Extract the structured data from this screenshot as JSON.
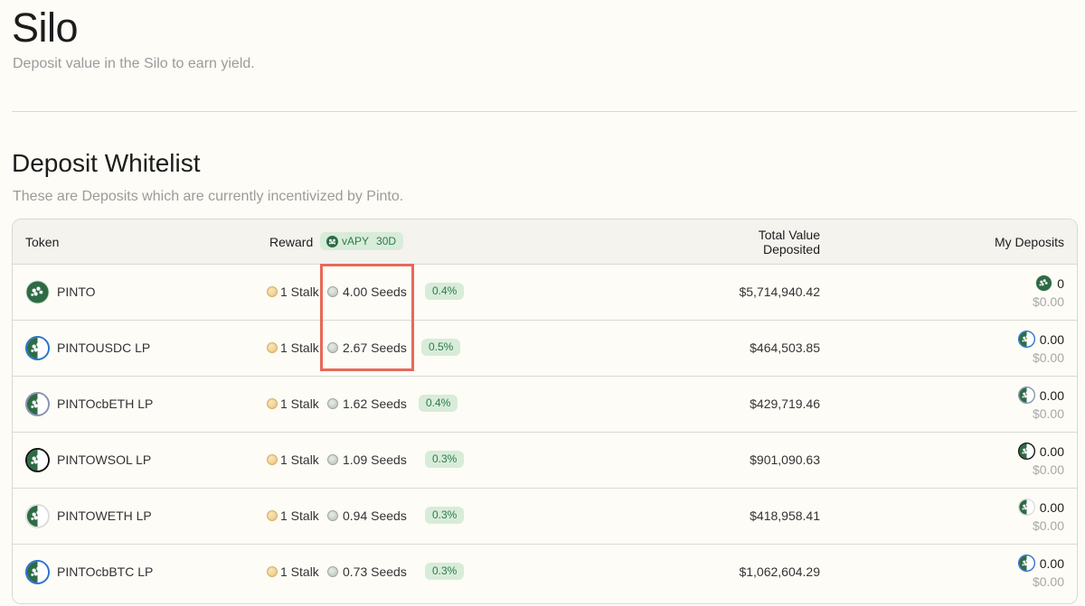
{
  "page": {
    "title": "Silo",
    "subtitle": "Deposit value in the Silo to earn yield."
  },
  "section": {
    "title": "Deposit Whitelist",
    "subtitle": "These are Deposits which are currently incentivized by Pinto."
  },
  "table": {
    "headers": {
      "token": "Token",
      "reward": "Reward",
      "vapy_label": "vAPY",
      "vapy_period": "30D",
      "total_line1": "Total Value",
      "total_line2": "Deposited",
      "my_deposits": "My Deposits"
    },
    "rows": [
      {
        "token": "PINTO",
        "icon": "pinto-icon",
        "stalk": "1 Stalk",
        "seeds": "4.00 Seeds",
        "apy": "0.4%",
        "total": "$5,714,940.42",
        "my_amount": "0",
        "my_value": "$0.00"
      },
      {
        "token": "PINTOUSDC LP",
        "icon": "pintousdc-lp-icon",
        "stalk": "1 Stalk",
        "seeds": "2.67 Seeds",
        "apy": "0.5%",
        "total": "$464,503.85",
        "my_amount": "0.00",
        "my_value": "$0.00"
      },
      {
        "token": "PINTOcbETH LP",
        "icon": "pintocbeth-lp-icon",
        "stalk": "1 Stalk",
        "seeds": "1.62 Seeds",
        "apy": "0.4%",
        "total": "$429,719.46",
        "my_amount": "0.00",
        "my_value": "$0.00"
      },
      {
        "token": "PINTOWSOL LP",
        "icon": "pintowsol-lp-icon",
        "stalk": "1 Stalk",
        "seeds": "1.09 Seeds",
        "apy": "0.3%",
        "total": "$901,090.63",
        "my_amount": "0.00",
        "my_value": "$0.00"
      },
      {
        "token": "PINTOWETH LP",
        "icon": "pintoweth-lp-icon",
        "stalk": "1 Stalk",
        "seeds": "0.94 Seeds",
        "apy": "0.3%",
        "total": "$418,958.41",
        "my_amount": "0.00",
        "my_value": "$0.00"
      },
      {
        "token": "PINTOcbBTC LP",
        "icon": "pintocbbtc-lp-icon",
        "stalk": "1 Stalk",
        "seeds": "0.73 Seeds",
        "apy": "0.3%",
        "total": "$1,062,604.29",
        "my_amount": "0.00",
        "my_value": "$0.00"
      }
    ]
  },
  "colors": {
    "background": "#fdfcf6",
    "pinto_green": "#2e6b45",
    "apy_badge_bg": "#d8ecd9",
    "apy_badge_text": "#2b7a4b",
    "highlight": "#e8685a"
  }
}
